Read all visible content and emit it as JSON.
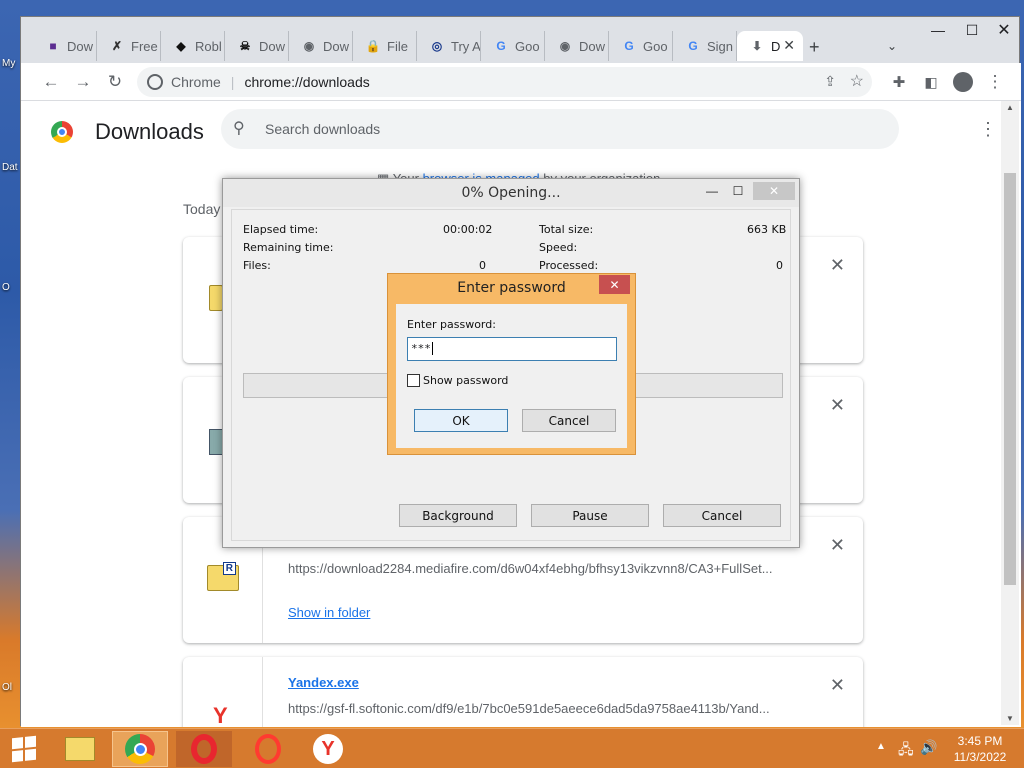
{
  "desktop": {
    "icons": [
      "My",
      "Dat",
      "O",
      "Ol"
    ]
  },
  "browser": {
    "tabs": [
      {
        "label": "Dow",
        "icon": "purple-square-icon",
        "color": "#5c2d91"
      },
      {
        "label": "Free",
        "icon": "runner-icon",
        "color": "#333333"
      },
      {
        "label": "Robl",
        "icon": "roblox-icon",
        "color": "#111111"
      },
      {
        "label": "Dow",
        "icon": "skull-icon",
        "color": "#111111"
      },
      {
        "label": "Dow",
        "icon": "globe-icon",
        "color": "#5f6368"
      },
      {
        "label": "File",
        "icon": "lock-icon",
        "color": "#c9a400"
      },
      {
        "label": "Try A",
        "icon": "signal-icon",
        "color": "#1a3a8c"
      },
      {
        "label": "Goo",
        "icon": "google-icon",
        "color": "#4285f4"
      },
      {
        "label": "Dow",
        "icon": "globe-icon",
        "color": "#5f6368"
      },
      {
        "label": "Goo",
        "icon": "google-icon",
        "color": "#4285f4"
      },
      {
        "label": "Sign",
        "icon": "google-icon",
        "color": "#4285f4"
      },
      {
        "label": "D",
        "icon": "download-icon",
        "color": "#5f6368",
        "active": true
      }
    ],
    "new_tab": "+",
    "omnibox": {
      "site_label": "Chrome",
      "url": "chrome://downloads"
    }
  },
  "downloads": {
    "title": "Downloads",
    "search_placeholder": "Search downloads",
    "managed_prefix": "Your ",
    "managed_link": "browser is managed",
    "managed_suffix": " by your organization",
    "today": "Today",
    "items": [
      {
        "url": "",
        "action": ""
      },
      {
        "url": "",
        "action": ""
      },
      {
        "url": "https://download2284.mediafire.com/d6w04xf4ebhg/bfhsy13vikzvnn8/CA3+FullSet...",
        "action": "Show in folder"
      },
      {
        "name": "Yandex.exe",
        "url": "https://gsf-fl.softonic.com/df9/e1b/7bc0e591de5aeece6dad5da9758ae4113b/Yand..."
      }
    ]
  },
  "rar_dialog": {
    "title": "0% Opening...",
    "elapsed_label": "Elapsed time:",
    "elapsed_value": "00:00:02",
    "remaining_label": "Remaining time:",
    "files_label": "Files:",
    "files_value": "0",
    "total_label": "Total size:",
    "total_value": "663 KB",
    "speed_label": "Speed:",
    "processed_label": "Processed:",
    "processed_value": "0",
    "progress": 0,
    "background_btn": "Background",
    "pause_btn": "Pause",
    "cancel_btn": "Cancel"
  },
  "password_dialog": {
    "title": "Enter password",
    "field_label": "Enter password:",
    "field_value": "***",
    "show_password": "Show password",
    "show_password_checked": false,
    "ok": "OK",
    "cancel": "Cancel"
  },
  "taskbar": {
    "time": "3:45 PM",
    "date": "11/3/2022",
    "accent": "#d67a2e"
  }
}
